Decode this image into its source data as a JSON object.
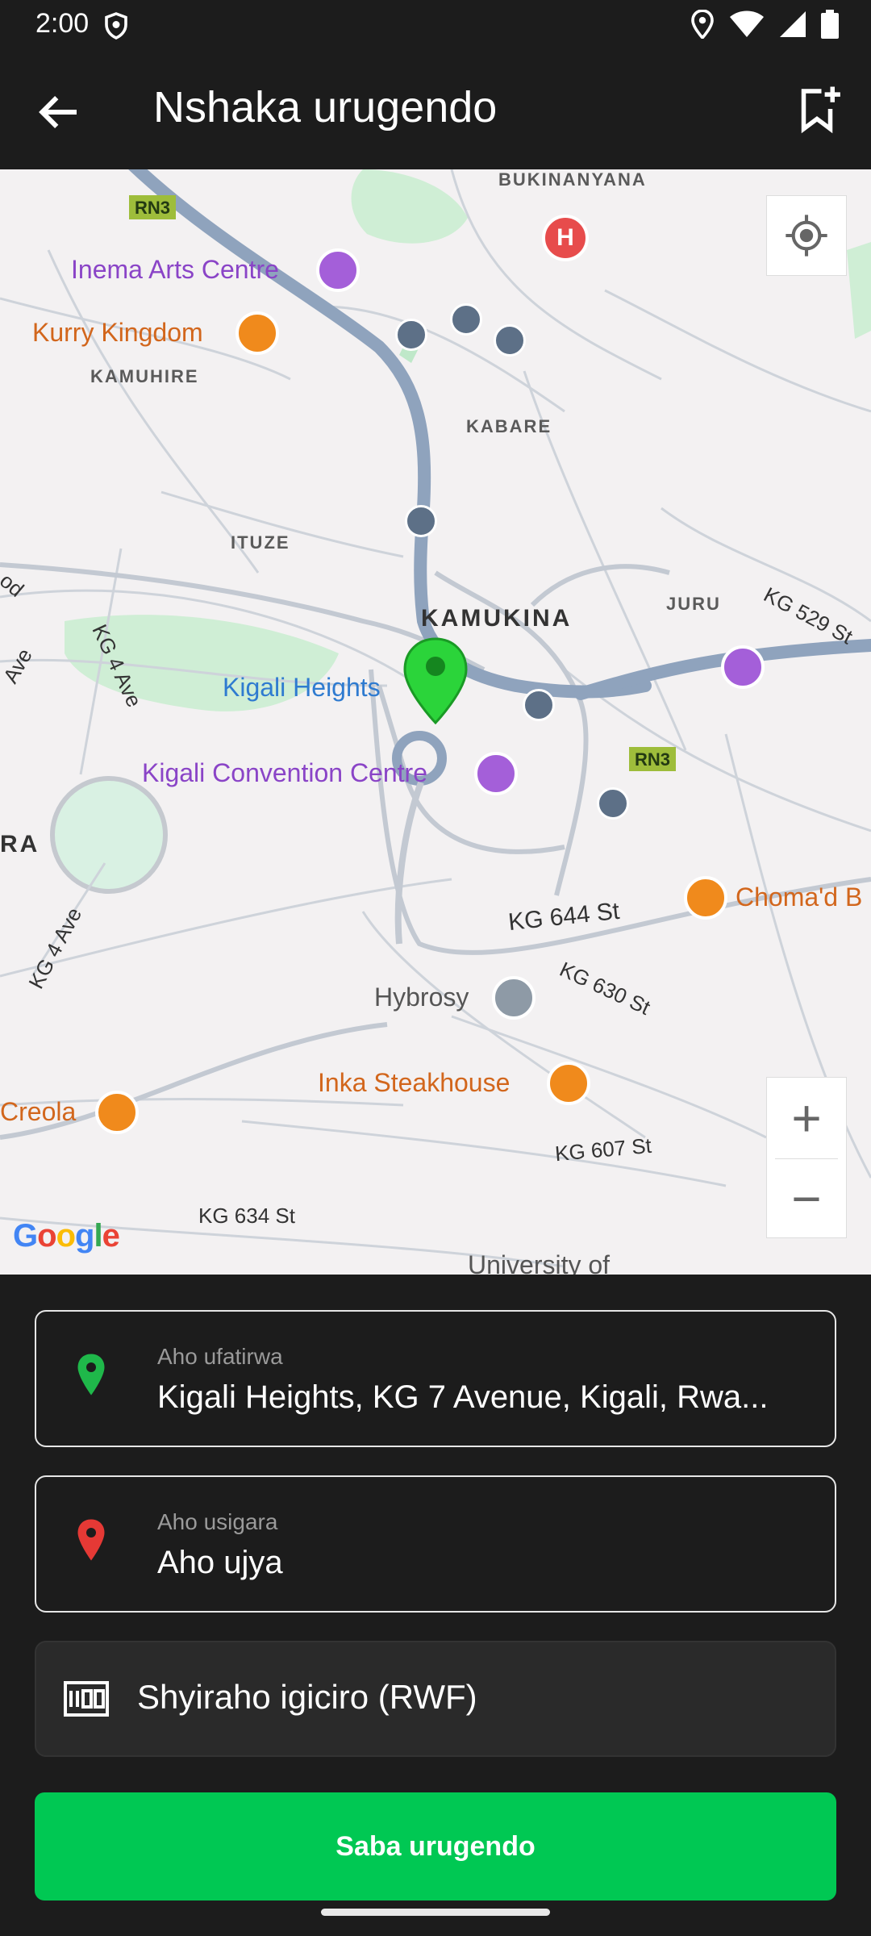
{
  "status_bar": {
    "time": "2:00"
  },
  "app_bar": {
    "title": "Nshaka urugendo"
  },
  "map": {
    "areas": [
      "BUKINANYANA",
      "KAMUHIRE",
      "KABARE",
      "ITUZE",
      "KAMUKINA",
      "JURU",
      "RA"
    ],
    "roads": [
      "RN3",
      "RN3",
      "KG 529 St",
      "KG 4 Ave",
      "Ave",
      "od",
      "KG 4 Ave",
      "KG 644 St",
      "KG 630 St",
      "KG 607 St",
      "KG 634 St"
    ],
    "pois": {
      "inema": "Inema Arts Centre",
      "kurry": "Kurry Kingdom",
      "kigali_heights": "Kigali Heights",
      "convention": "Kigali Convention Centre",
      "chomad": "Choma'd B",
      "hybrosy": "Hybrosy",
      "inka": "Inka Steakhouse",
      "creola": "Creola",
      "university": "University of"
    },
    "zoom_in": "+",
    "zoom_out": "−",
    "logo": [
      "G",
      "o",
      "o",
      "g",
      "l",
      "e"
    ]
  },
  "origin": {
    "label": "Aho ufatirwa",
    "value": "Kigali Heights, KG 7 Avenue, Kigali, Rwa..."
  },
  "destination": {
    "label": "Aho usigara",
    "value": "Aho ujya"
  },
  "price": {
    "placeholder": "Shyiraho igiciro (RWF)"
  },
  "submit": {
    "label": "Saba urugendo"
  },
  "colors": {
    "accent": "#00c853",
    "origin_pin": "#1fb84a",
    "destination_pin": "#e53935"
  },
  "icons": [
    "shield-icon",
    "location-icon",
    "wifi-icon",
    "signal-icon",
    "battery-icon",
    "back-arrow-icon",
    "bookmark-add-icon",
    "my-location-icon",
    "map-pin-icon",
    "money-icon"
  ]
}
